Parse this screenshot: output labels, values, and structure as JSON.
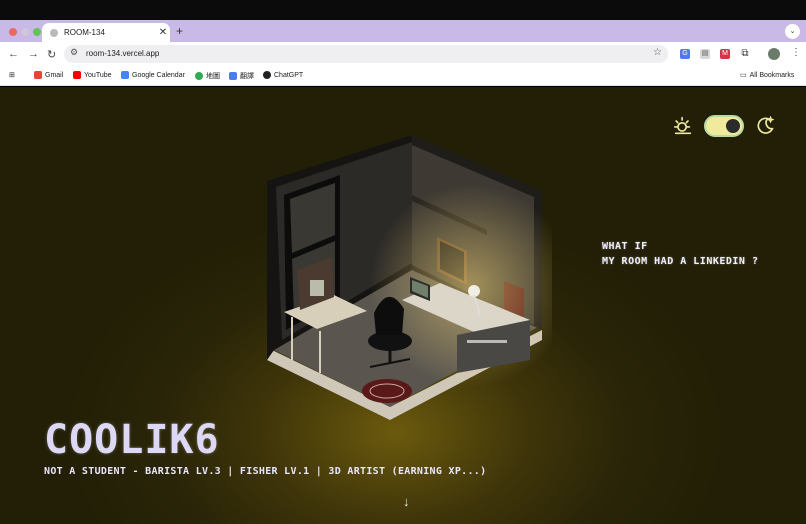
{
  "browser": {
    "tab_title": "ROOM-134",
    "url": "room-134.vercel.app",
    "bookmarks": [
      "Gmail",
      "YouTube",
      "Google Calendar",
      "地圖",
      "翻譯",
      "ChatGPT"
    ],
    "all_bookmarks": "All Bookmarks"
  },
  "page": {
    "tagline_line1": "WHAT IF",
    "tagline_line2": "MY ROOM HAD A LINKEDIN ?",
    "name": "COOLIK6",
    "subtitle": "NOT A STUDENT - BARISTA LV.3 | FISHER LV.1 | 3D ARTIST (EARNING XP...)",
    "theme_toggle_on": true,
    "scroll_glyph": "↓"
  },
  "colors": {
    "tabstrip": "#c9b9e6",
    "background": "#221f06",
    "glow": "#6b5a0d",
    "text": "#e9e6fb",
    "toggle_track": "#f0ea9e",
    "toggle_border": "#b7dba7"
  }
}
